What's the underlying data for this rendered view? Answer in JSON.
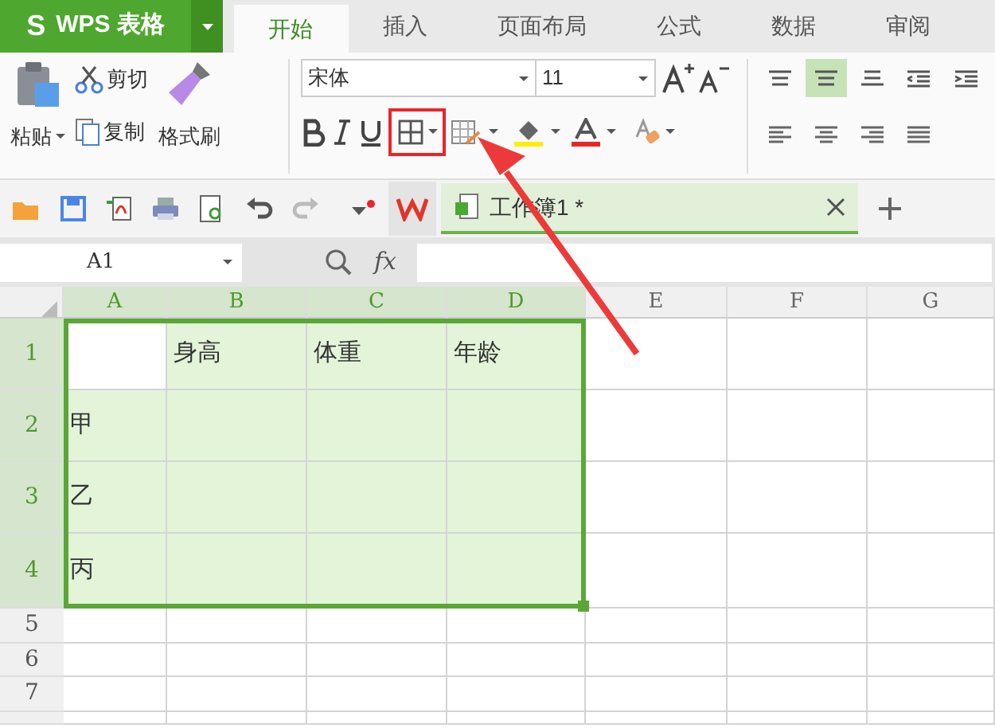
{
  "app_menu": {
    "logo": "S",
    "title": "WPS 表格"
  },
  "ribbon_tabs": [
    {
      "label": "开始",
      "selected": true
    },
    {
      "label": "插入",
      "selected": false
    },
    {
      "label": "页面布局",
      "selected": false
    },
    {
      "label": "公式",
      "selected": false
    },
    {
      "label": "数据",
      "selected": false
    },
    {
      "label": "审阅",
      "selected": false
    }
  ],
  "clipboard": {
    "paste": "粘贴",
    "cut": "剪切",
    "copy": "复制",
    "format_painter": "格式刷"
  },
  "font": {
    "name": "宋体",
    "size": "11"
  },
  "alignment_buttons": [
    {
      "selected": false
    },
    {
      "selected": true
    },
    {
      "selected": false
    },
    {
      "selected": false
    },
    {
      "selected": false
    },
    {
      "selected": false
    },
    {
      "selected": false
    },
    {
      "selected": false
    },
    {
      "selected": false
    }
  ],
  "document_tabs": [
    {
      "title": "工作簿1 *",
      "selected": true
    }
  ],
  "name_box": "A1",
  "function_label": "fx",
  "columns": [
    {
      "label": "A",
      "selected": true
    },
    {
      "label": "B",
      "selected": true
    },
    {
      "label": "C",
      "selected": true
    },
    {
      "label": "D",
      "selected": true
    },
    {
      "label": "E",
      "selected": false
    },
    {
      "label": "F",
      "selected": false
    },
    {
      "label": "G",
      "selected": false
    }
  ],
  "rows": [
    {
      "label": "1",
      "selected": true,
      "cells": [
        {
          "selected": true,
          "active": true
        },
        {
          "text": "身高",
          "selected": true
        },
        {
          "text": "体重",
          "selected": true
        },
        {
          "text": "年龄",
          "selected": true
        },
        {
          "selected": false
        },
        {
          "selected": false
        },
        {
          "selected": false
        }
      ]
    },
    {
      "label": "2",
      "selected": true,
      "cells": [
        {
          "text": "甲",
          "selected": true
        },
        {
          "selected": true
        },
        {
          "selected": true
        },
        {
          "selected": true
        },
        {
          "selected": false
        },
        {
          "selected": false
        },
        {
          "selected": false
        }
      ]
    },
    {
      "label": "3",
      "selected": true,
      "cells": [
        {
          "text": "乙",
          "selected": true
        },
        {
          "selected": true
        },
        {
          "selected": true
        },
        {
          "selected": true
        },
        {
          "selected": false
        },
        {
          "selected": false
        },
        {
          "selected": false
        }
      ]
    },
    {
      "label": "4",
      "selected": true,
      "cells": [
        {
          "text": "丙",
          "selected": true
        },
        {
          "selected": true
        },
        {
          "selected": true
        },
        {
          "selected": true
        },
        {
          "selected": false
        },
        {
          "selected": false
        },
        {
          "selected": false
        }
      ]
    },
    {
      "label": "5",
      "selected": false,
      "cells": [
        {
          "selected": false
        },
        {
          "selected": false
        },
        {
          "selected": false
        },
        {
          "selected": false
        },
        {
          "selected": false
        },
        {
          "selected": false
        },
        {
          "selected": false
        }
      ]
    },
    {
      "label": "6",
      "selected": false,
      "cells": [
        {
          "selected": false
        },
        {
          "selected": false
        },
        {
          "selected": false
        },
        {
          "selected": false
        },
        {
          "selected": false
        },
        {
          "selected": false
        },
        {
          "selected": false
        }
      ]
    },
    {
      "label": "7",
      "selected": false,
      "cells": [
        {
          "selected": false
        },
        {
          "selected": false
        },
        {
          "selected": false
        },
        {
          "selected": false
        },
        {
          "selected": false
        },
        {
          "selected": false
        },
        {
          "selected": false
        }
      ]
    }
  ],
  "annotations": {
    "highlight_box": true,
    "arrow": true
  }
}
